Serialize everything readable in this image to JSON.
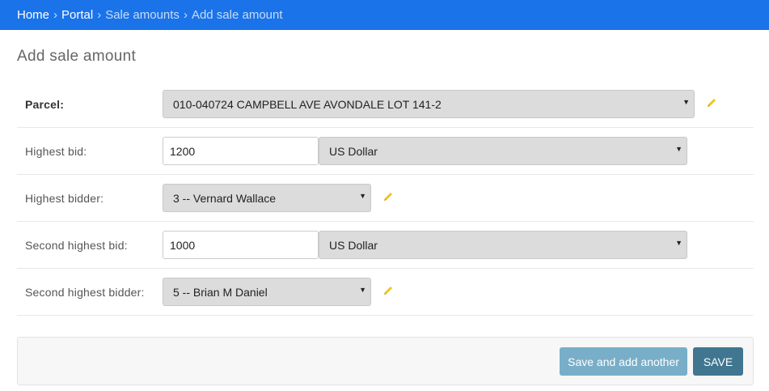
{
  "breadcrumbs": {
    "home": "Home",
    "portal": "Portal",
    "sale_amounts": "Sale amounts",
    "current": "Add sale amount",
    "separator": "›"
  },
  "page": {
    "title": "Add sale amount"
  },
  "form": {
    "parcel": {
      "label": "Parcel:",
      "value": "010-040724 CAMPBELL AVE AVONDALE LOT 141-2"
    },
    "highest_bid": {
      "label": "Highest bid:",
      "amount": "1200",
      "currency": "US Dollar"
    },
    "highest_bidder": {
      "label": "Highest bidder:",
      "value": "3 -- Vernard Wallace"
    },
    "second_highest_bid": {
      "label": "Second highest bid:",
      "amount": "1000",
      "currency": "US Dollar"
    },
    "second_highest_bidder": {
      "label": "Second highest bidder:",
      "value": "5 -- Brian M Daniel"
    }
  },
  "actions": {
    "save_add_another": "Save and add another",
    "save": "SAVE"
  },
  "icons": {
    "edit": "pencil-icon",
    "dropdown": "caret-down-icon"
  },
  "colors": {
    "header": "#1a73e8",
    "primary_button": "#417690",
    "secondary_button": "#79aec8",
    "edit_icon": "#f0c419"
  }
}
